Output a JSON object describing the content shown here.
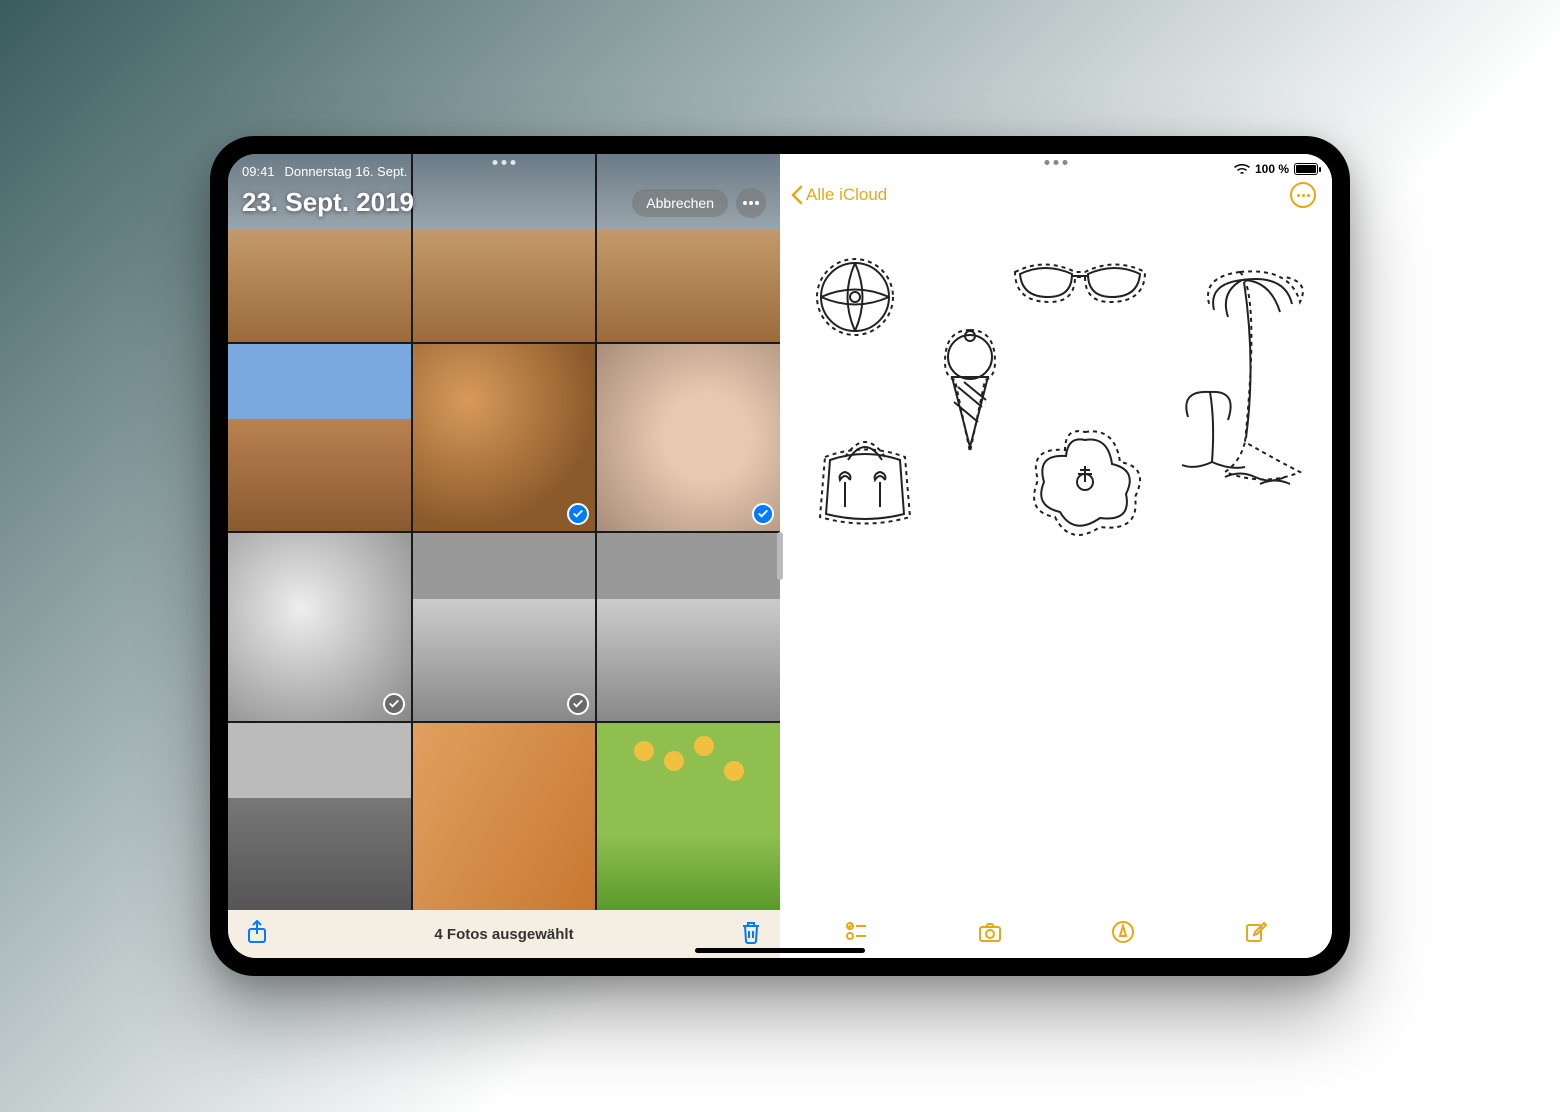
{
  "status": {
    "time": "09:41",
    "date": "Donnerstag 16. Sept.",
    "battery_pct": "100 %"
  },
  "photos": {
    "title": "23. Sept. 2019",
    "cancel_label": "Abbrechen",
    "selected_text": "4 Fotos ausgewählt",
    "thumbs": [
      {
        "id": "rock-hiker-1",
        "selected": false
      },
      {
        "id": "rock-hiker-2",
        "selected": false
      },
      {
        "id": "rock-hiker-3",
        "selected": false
      },
      {
        "id": "canyon-road",
        "selected": false
      },
      {
        "id": "slot-canyon-person",
        "selected": true
      },
      {
        "id": "eye-closeup",
        "selected": true
      },
      {
        "id": "bw-flowers",
        "selected": true
      },
      {
        "id": "bw-dunes",
        "selected": true
      },
      {
        "id": "bw-rock-waves",
        "selected": false
      },
      {
        "id": "bw-lone-tree",
        "selected": false
      },
      {
        "id": "sand-hands",
        "selected": false
      },
      {
        "id": "sunflower-girl",
        "selected": false
      }
    ]
  },
  "notes": {
    "back_label": "Alle iCloud",
    "sketches": [
      "beach-ball",
      "sunglasses",
      "ice-cream-cone",
      "palm-trees",
      "beach-bag",
      "hibiscus-flower"
    ]
  },
  "colors": {
    "ios_blue": "#007aff",
    "notes_yellow": "#e6a817"
  }
}
